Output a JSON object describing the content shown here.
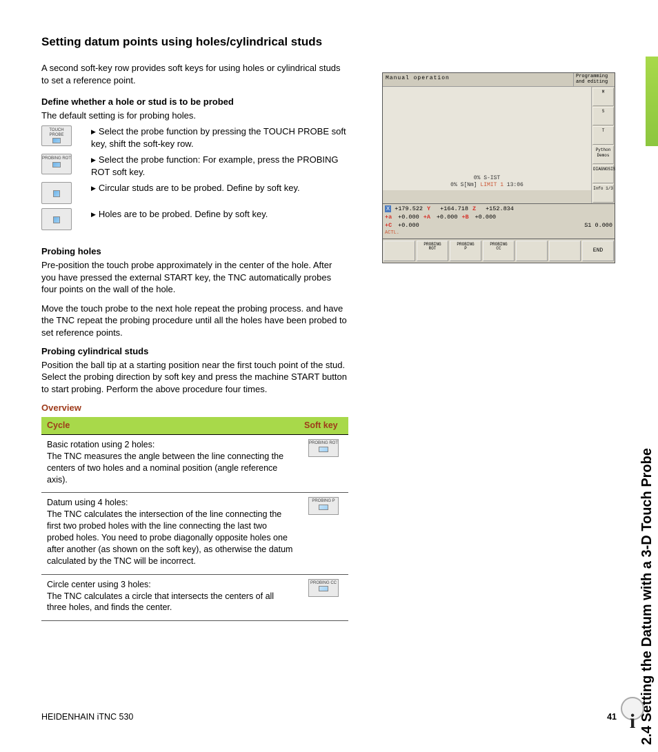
{
  "sideTab": "2.4 Setting the Datum with a 3-D Touch Probe",
  "title": "Setting datum points using holes/cylindrical studs",
  "intro": "A second soft-key row provides soft keys for using holes or cylindrical studs to set a reference point.",
  "sub1": "Define whether a hole or stud is to be probed",
  "defaultNote": "The default setting is for probing holes.",
  "steps": [
    {
      "icon": "TOUCH\nPROBE",
      "text": "Select the probe function by pressing the TOUCH PROBE soft key, shift the soft-key row."
    },
    {
      "icon": "PROBING\nROT",
      "text": "Select the probe function: For example, press the PROBING ROT soft key."
    },
    {
      "icon": "",
      "text": "Circular studs are to be probed. Define by soft key."
    },
    {
      "icon": "",
      "text": "Holes are to be probed. Define by soft key."
    }
  ],
  "sub2": "Probing holes",
  "para2a": "Pre-position the touch probe approximately in the center of the hole. After you have pressed the external START key, the TNC automatically probes four points on the wall of the hole.",
  "para2b": "Move the touch probe to the next hole repeat the probing process. and have the TNC repeat the probing procedure until all the holes have been probed to set reference points.",
  "sub3": "Probing cylindrical studs",
  "para3": "Position the ball tip at a starting position near the first touch point of the stud. Select the probing direction by soft key and press the machine START button to start probing. Perform the above procedure four times.",
  "overviewHead": "Overview",
  "table": {
    "headers": [
      "Cycle",
      "Soft key"
    ],
    "rows": [
      {
        "cycle": "Basic rotation using 2 holes:\nThe TNC measures the angle between the line connecting the centers of two holes and a nominal position (angle reference axis).",
        "sk": "PROBING\nROT"
      },
      {
        "cycle": "Datum using 4 holes:\nThe TNC calculates the intersection of the line connecting the first two probed holes with the line connecting the last two probed holes. You need to probe diagonally opposite holes one after another (as shown on the soft key), as otherwise the datum calculated by the TNC will be incorrect.",
        "sk": "PROBING\nP"
      },
      {
        "cycle": "Circle center using 3 holes:\nThe TNC calculates a circle that intersects the centers of all three holes, and finds the center.",
        "sk": "PROBING\nCC"
      }
    ]
  },
  "tnc": {
    "title": "Manual operation",
    "subTitle": "Programming\nand editing",
    "status1": "0% S-IST",
    "status2": "0% S[Nm] LIMIT 1 13:06",
    "rows": [
      [
        "X",
        "+179.522",
        "Y",
        "+164.718",
        "Z",
        "+152.834"
      ],
      [
        "+a",
        "+0.000",
        "+A",
        "+0.000",
        "+B",
        "+0.000"
      ],
      [
        "+C",
        "+0.000",
        "",
        "",
        "",
        ""
      ]
    ],
    "s1": "S1   0.000",
    "actl": "ACTL.",
    "softkeys": [
      "",
      "PROBING\nROT",
      "PROBING\nP",
      "PROBING\nCC",
      "",
      "",
      "END"
    ],
    "side": [
      "M",
      "S",
      "T",
      "Python\nDemos",
      "DIAGNOSIS",
      "Info 1/3"
    ]
  },
  "footerLeft": "HEIDENHAIN iTNC 530",
  "footerRight": "41"
}
